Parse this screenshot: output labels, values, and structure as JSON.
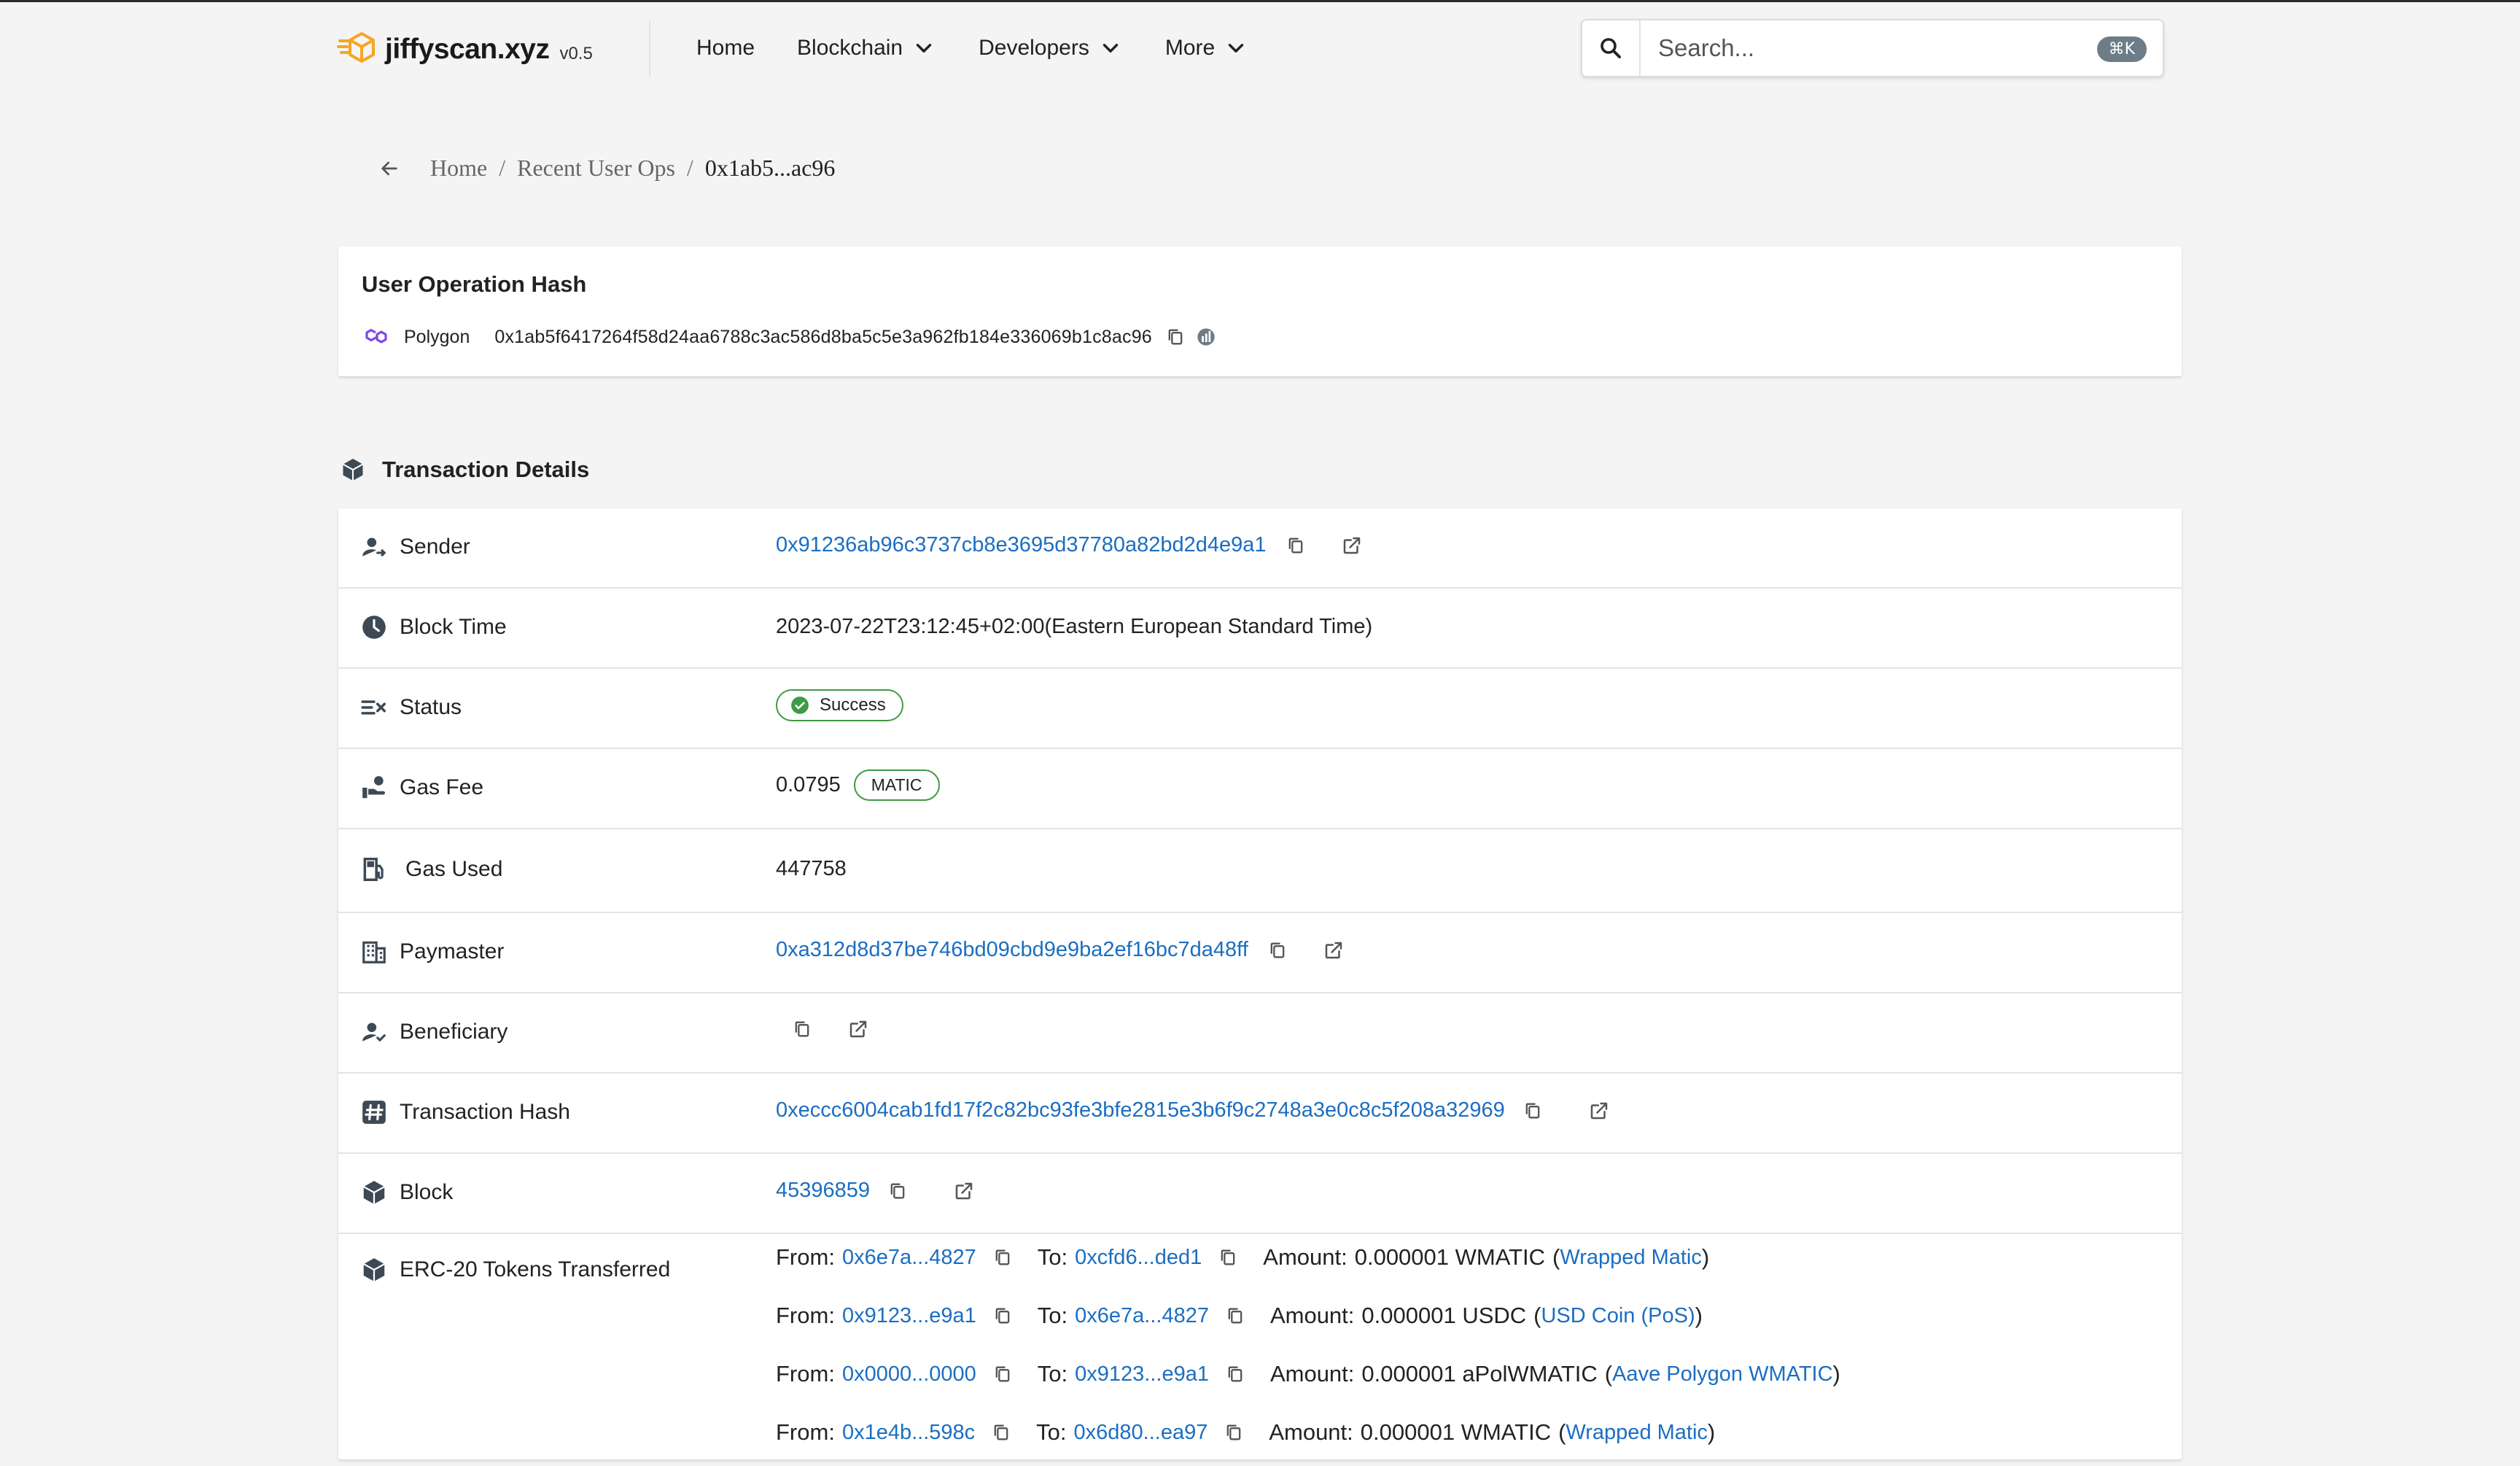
{
  "app": {
    "name": "jiffyscan.xyz",
    "version": "v0.5"
  },
  "nav": {
    "home": "Home",
    "blockchain": "Blockchain",
    "developers": "Developers",
    "more": "More"
  },
  "search": {
    "placeholder": "Search...",
    "shortcut": "⌘K"
  },
  "breadcrumb": {
    "home": "Home",
    "sep": "/",
    "recent": "Recent User Ops",
    "current": "0x1ab5...ac96"
  },
  "hash_card": {
    "title": "User Operation Hash",
    "network": "Polygon",
    "hash": "0x1ab5f6417264f58d24aa6788c3ac586d8ba5c5e3a962fb184e336069b1c8ac96"
  },
  "section": {
    "title": "Transaction Details"
  },
  "details": {
    "sender": {
      "label": "Sender",
      "value": "0x91236ab96c3737cb8e3695d37780a82bd2d4e9a1"
    },
    "block_time": {
      "label": "Block Time",
      "value": "2023-07-22T23:12:45+02:00(Eastern European Standard Time)"
    },
    "status": {
      "label": "Status",
      "value": "Success"
    },
    "gas_fee": {
      "label": "Gas Fee",
      "value": "0.0795",
      "unit": "MATIC"
    },
    "gas_used": {
      "label": "Gas Used",
      "value": "447758"
    },
    "paymaster": {
      "label": "Paymaster",
      "value": "0xa312d8d37be746bd09cbd9e9ba2ef16bc7da48ff"
    },
    "beneficiary": {
      "label": "Beneficiary",
      "value": ""
    },
    "tx_hash": {
      "label": "Transaction Hash",
      "value": "0xeccc6004cab1fd17f2c82bc93fe3bfe2815e3b6f9c2748a3e0c8c5f208a32969"
    },
    "block": {
      "label": "Block",
      "value": "45396859"
    },
    "erc20": {
      "label": "ERC-20 Tokens Transferred",
      "from_label": "From:",
      "to_label": "To:",
      "amount_label": "Amount:",
      "transfers": [
        {
          "from": "0x6e7a...4827",
          "to": "0xcfd6...ded1",
          "amount": "0.000001 WMATIC",
          "token": "Wrapped Matic"
        },
        {
          "from": "0x9123...e9a1",
          "to": "0x6e7a...4827",
          "amount": "0.000001 USDC",
          "token": "USD Coin (PoS)"
        },
        {
          "from": "0x0000...0000",
          "to": "0x9123...e9a1",
          "amount": "0.000001 aPolWMATIC",
          "token": "Aave Polygon WMATIC"
        },
        {
          "from": "0x1e4b...598c",
          "to": "0x6d80...ea97",
          "amount": "0.000001 WMATIC",
          "token": "Wrapped Matic"
        }
      ]
    }
  },
  "colors": {
    "link": "#1b6ec2",
    "success": "#3f9b45",
    "logo": "#f5a623",
    "polygon": "#8247e5"
  }
}
